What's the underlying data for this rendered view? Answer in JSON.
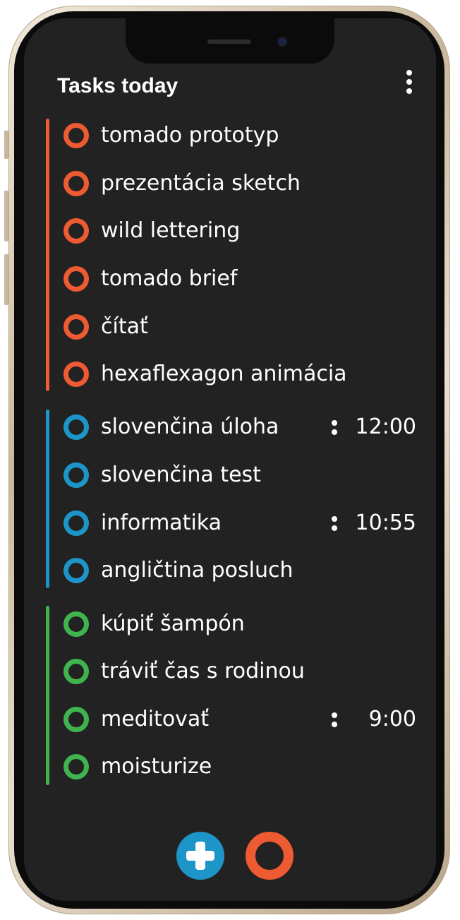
{
  "header": {
    "title": "Tasks today"
  },
  "colors": {
    "work": "#ee5a32",
    "school": "#1e95c9",
    "personal": "#3fb44e",
    "background": "#222222"
  },
  "icons": {
    "menu": "vertical-ellipsis-icon",
    "task_status": "ring-icon",
    "add": "plus-icon",
    "focus": "ring-icon"
  },
  "groups": [
    {
      "color": "#ee5a32",
      "tasks": [
        {
          "label": "tomado prototyp"
        },
        {
          "label": "prezentácia sketch"
        },
        {
          "label": "wild lettering"
        },
        {
          "label": "tomado brief"
        },
        {
          "label": "čítať"
        },
        {
          "label": "hexaflexagon animácia"
        }
      ]
    },
    {
      "color": "#1e95c9",
      "tasks": [
        {
          "label": "slovenčina úloha",
          "time": "12:00"
        },
        {
          "label": "slovenčina test"
        },
        {
          "label": "informatika",
          "time": "10:55"
        },
        {
          "label": "angličtina posluch"
        }
      ]
    },
    {
      "color": "#3fb44e",
      "tasks": [
        {
          "label": "kúpiť šampón"
        },
        {
          "label": "tráviť čas s rodinou"
        },
        {
          "label": "meditovať",
          "time": "9:00"
        },
        {
          "label": "moisturize"
        }
      ]
    }
  ]
}
